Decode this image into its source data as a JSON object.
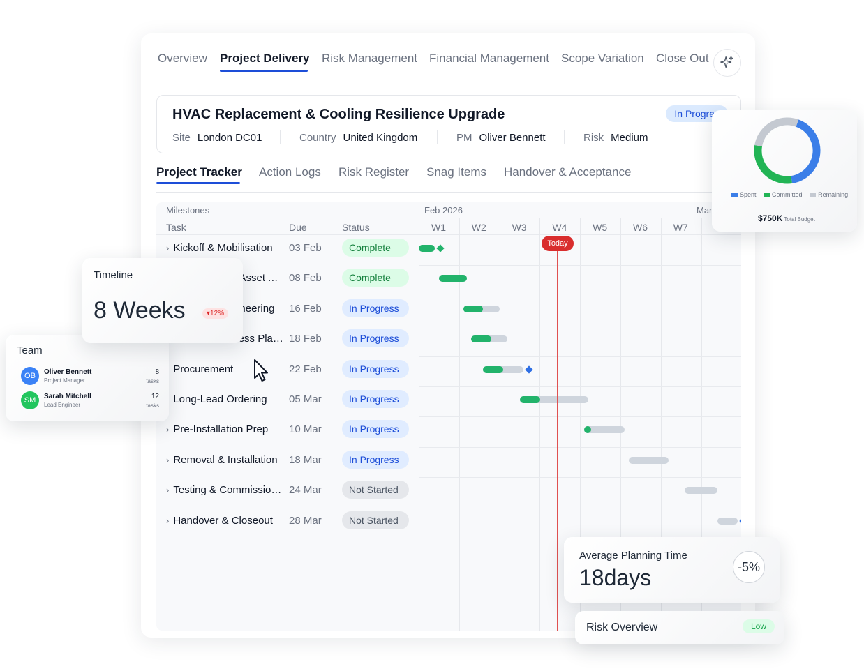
{
  "topnav": {
    "tabs": [
      "Overview",
      "Project Delivery",
      "Risk Management",
      "Financial Management",
      "Scope Variation",
      "Close Out"
    ],
    "active": "Project Delivery",
    "assistant_icon": "sparkle-icon"
  },
  "project": {
    "title": "HVAC Replacement & Cooling Resilience Upgrade",
    "status": "In Progres",
    "site_label": "Site",
    "site": "London DC01",
    "country_label": "Country",
    "country": "United Kingdom",
    "pm_label": "PM",
    "pm": "Oliver Bennett",
    "risk_label": "Risk",
    "risk": "Medium"
  },
  "subnav": {
    "tabs": [
      "Project Tracker",
      "Action Logs",
      "Risk Register",
      "Snag Items",
      "Handover & Acceptance"
    ],
    "active": "Project Tracker"
  },
  "gantt": {
    "section_label": "Milestones",
    "month_feb": "Feb 2026",
    "month_mar": "Mar",
    "col_task": "Task",
    "col_due": "Due",
    "col_status": "Status",
    "weeks": [
      "W1",
      "W2",
      "W3",
      "W4",
      "W5",
      "W6",
      "W7"
    ],
    "today_label": "Today",
    "today_week": 4.0,
    "rows": [
      {
        "task": "Kickoff & Mobilisation",
        "due": "03 Feb",
        "status": "Complete"
      },
      {
        "task": "Site Survey & Asset Assessment",
        "due": "08 Feb",
        "status": "Complete"
      },
      {
        "task": "Design & Engineering",
        "due": "16 Feb",
        "status": "In Progress"
      },
      {
        "task": "Permits & Access Planning",
        "due": "18 Feb",
        "status": "In Progress"
      },
      {
        "task": "Procurement",
        "due": "22 Feb",
        "status": "In Progress"
      },
      {
        "task": "Long-Lead Ordering",
        "due": "05 Mar",
        "status": "In Progress"
      },
      {
        "task": "Pre-Installation Prep",
        "due": "10 Mar",
        "status": "In Progress"
      },
      {
        "task": "Removal & Installation",
        "due": "18 Mar",
        "status": "In Progress"
      },
      {
        "task": "Testing & Commissioning",
        "due": "24 Mar",
        "status": "Not Started"
      },
      {
        "task": "Handover & Closeout",
        "due": "28 Mar",
        "status": "Not Started"
      }
    ],
    "bars": [
      {
        "start": 1.0,
        "end": 1.4,
        "progress": 1.0,
        "milestone": "green"
      },
      {
        "start": 1.5,
        "end": 2.2,
        "progress": 1.0
      },
      {
        "start": 2.1,
        "end": 3.0,
        "progress": 0.55
      },
      {
        "start": 2.3,
        "end": 3.2,
        "progress": 0.55
      },
      {
        "start": 2.6,
        "end": 3.6,
        "progress": 0.5,
        "milestone": "blue"
      },
      {
        "start": 3.5,
        "end": 5.2,
        "progress": 0.3
      },
      {
        "start": 5.1,
        "end": 6.1,
        "progress": 0.15
      },
      {
        "start": 6.2,
        "end": 7.2,
        "progress": 0.0
      },
      {
        "start": 7.6,
        "end": 8.4,
        "progress": 0.0
      },
      {
        "start": 8.4,
        "end": 8.9,
        "progress": 0.0,
        "milestone": "blue"
      }
    ]
  },
  "timeline_card": {
    "label": "Timeline",
    "value": "8 Weeks",
    "delta": "12%"
  },
  "team_card": {
    "label": "Team",
    "members": [
      {
        "initials": "OB",
        "name": "Oliver Bennett",
        "role": "Project Manager",
        "count": "8",
        "unit": "tasks",
        "color": "#3b82f6"
      },
      {
        "initials": "SM",
        "name": "Sarah Mitchell",
        "role": "Lead Engineer",
        "count": "12",
        "unit": "tasks",
        "color": "#22c55e"
      }
    ]
  },
  "budget_card": {
    "legend": [
      "Spent",
      "Committed",
      "Remaining"
    ],
    "colors": {
      "spent": "#3b7ee8",
      "committed": "#22b455",
      "remaining": "#c4c9d1"
    },
    "shares": {
      "spent": 0.42,
      "committed": 0.3,
      "remaining": 0.28
    },
    "value": "$750K",
    "value_sub": "Total Budget"
  },
  "planning_card": {
    "label": "Average Planning Time",
    "value": "18days",
    "delta": "-5%"
  },
  "risk_card": {
    "label": "Risk Overview",
    "level": "Low"
  }
}
